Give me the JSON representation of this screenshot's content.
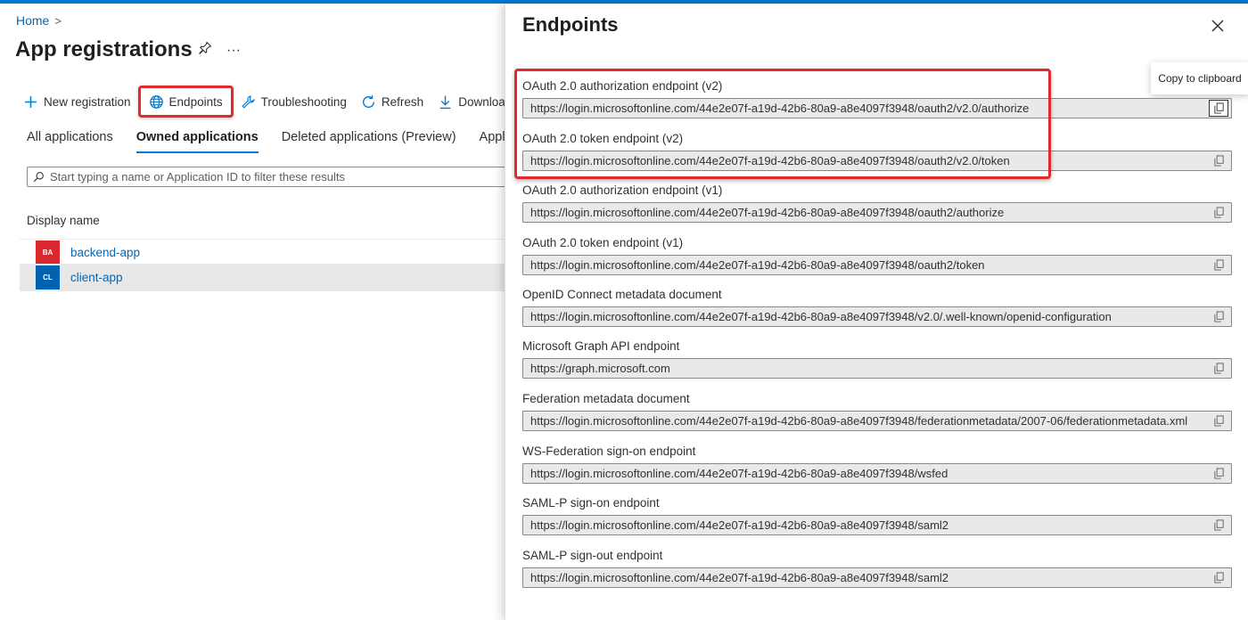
{
  "breadcrumb": {
    "home": "Home",
    "separator": ">"
  },
  "page": {
    "title": "App registrations",
    "pin_icon": "pin-icon",
    "more": "···"
  },
  "toolbar": {
    "new_registration": "New registration",
    "endpoints": "Endpoints",
    "troubleshooting": "Troubleshooting",
    "refresh": "Refresh",
    "download": "Download"
  },
  "tabs": [
    "All applications",
    "Owned applications",
    "Deleted applications (Preview)",
    "Applications"
  ],
  "active_tab": "Owned applications",
  "filter": {
    "placeholder": "Start typing a name or Application ID to filter these results"
  },
  "table": {
    "column": "Display name",
    "rows": [
      {
        "initials": "BA",
        "name": "backend-app",
        "color": "#d9272e"
      },
      {
        "initials": "CL",
        "name": "client-app",
        "color": "#0063b1"
      }
    ]
  },
  "panel": {
    "title": "Endpoints",
    "close_icon": "close-icon",
    "tooltip": "Copy to clipboard",
    "endpoints": [
      {
        "label": "OAuth 2.0 authorization endpoint (v2)",
        "url": "https://login.microsoftonline.com/44e2e07f-a19d-42b6-80a9-a8e4097f3948/oauth2/v2.0/authorize"
      },
      {
        "label": "OAuth 2.0 token endpoint (v2)",
        "url": "https://login.microsoftonline.com/44e2e07f-a19d-42b6-80a9-a8e4097f3948/oauth2/v2.0/token"
      },
      {
        "label": "OAuth 2.0 authorization endpoint (v1)",
        "url": "https://login.microsoftonline.com/44e2e07f-a19d-42b6-80a9-a8e4097f3948/oauth2/authorize"
      },
      {
        "label": "OAuth 2.0 token endpoint (v1)",
        "url": "https://login.microsoftonline.com/44e2e07f-a19d-42b6-80a9-a8e4097f3948/oauth2/token"
      },
      {
        "label": "OpenID Connect metadata document",
        "url": "https://login.microsoftonline.com/44e2e07f-a19d-42b6-80a9-a8e4097f3948/v2.0/.well-known/openid-configuration"
      },
      {
        "label": "Microsoft Graph API endpoint",
        "url": "https://graph.microsoft.com"
      },
      {
        "label": "Federation metadata document",
        "url": "https://login.microsoftonline.com/44e2e07f-a19d-42b6-80a9-a8e4097f3948/federationmetadata/2007-06/federationmetadata.xml"
      },
      {
        "label": "WS-Federation sign-on endpoint",
        "url": "https://login.microsoftonline.com/44e2e07f-a19d-42b6-80a9-a8e4097f3948/wsfed"
      },
      {
        "label": "SAML-P sign-on endpoint",
        "url": "https://login.microsoftonline.com/44e2e07f-a19d-42b6-80a9-a8e4097f3948/saml2"
      },
      {
        "label": "SAML-P sign-out endpoint",
        "url": "https://login.microsoftonline.com/44e2e07f-a19d-42b6-80a9-a8e4097f3948/saml2"
      }
    ]
  },
  "colors": {
    "accent": "#0078d4",
    "link": "#0067b8",
    "highlight": "#e02b2b"
  }
}
